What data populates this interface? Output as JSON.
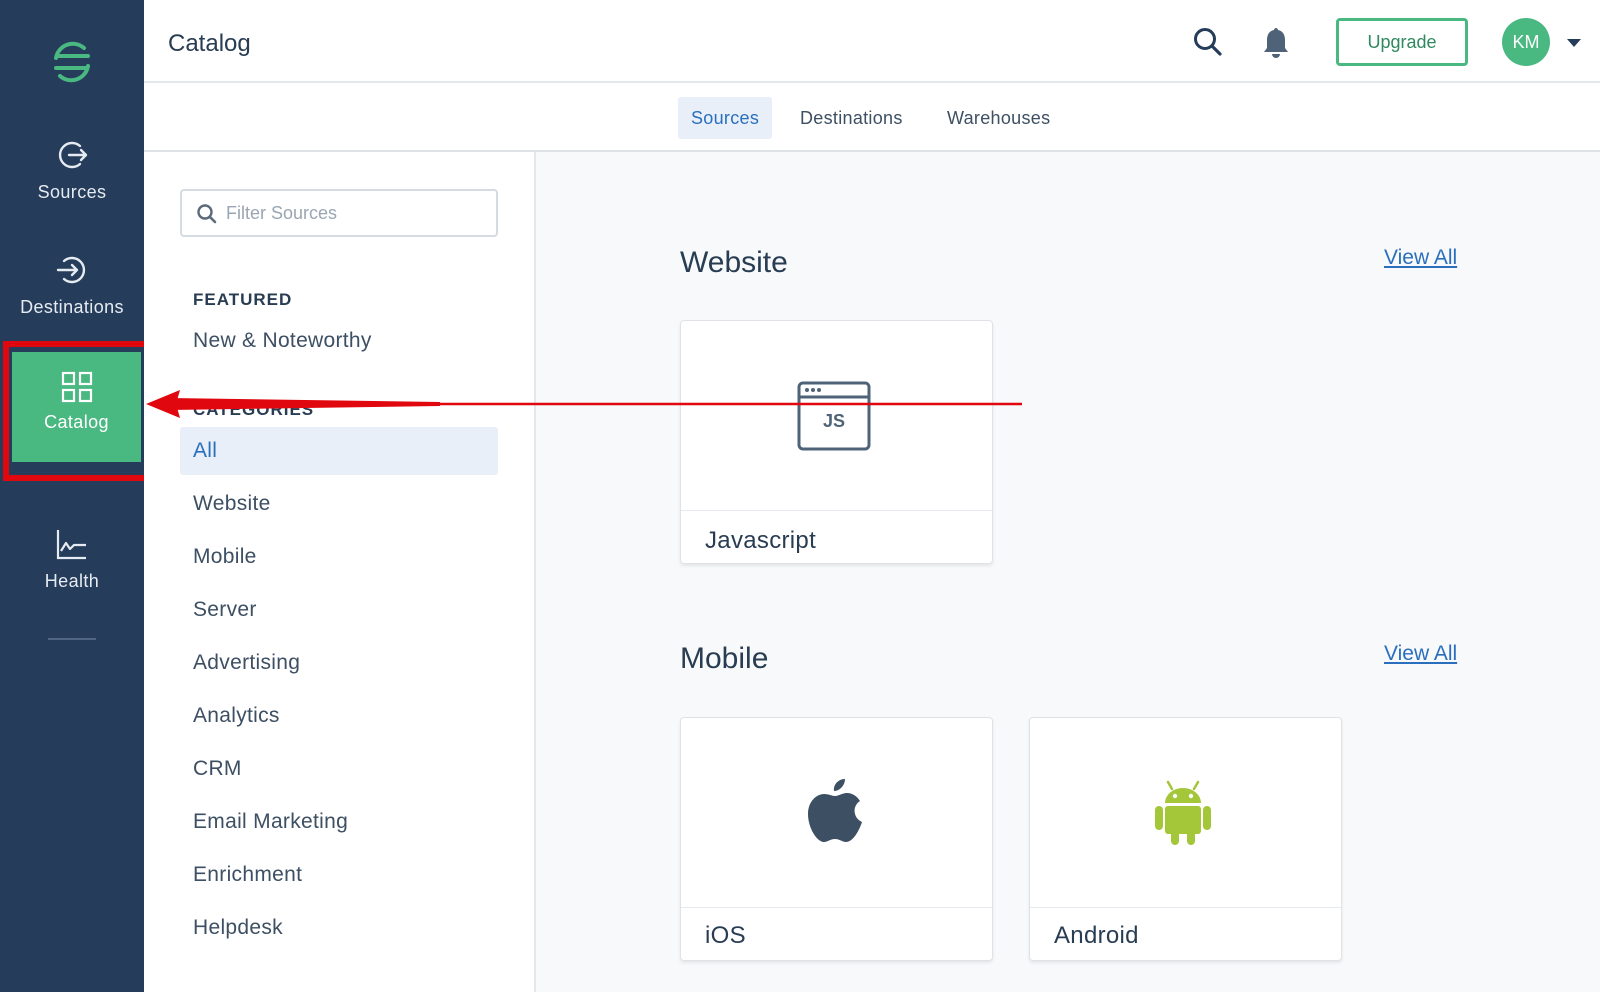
{
  "nav": {
    "items": [
      {
        "label": "Sources",
        "icon": "sources-icon"
      },
      {
        "label": "Destinations",
        "icon": "destinations-icon"
      },
      {
        "label": "Catalog",
        "icon": "catalog-grid-icon",
        "active": true
      },
      {
        "label": "Health",
        "icon": "health-chart-icon"
      }
    ],
    "active_color": "#49b881",
    "background": "#253d5b"
  },
  "header": {
    "title": "Catalog",
    "upgrade_label": "Upgrade",
    "avatar_initials": "KM"
  },
  "tabs": [
    {
      "label": "Sources",
      "active": true
    },
    {
      "label": "Destinations"
    },
    {
      "label": "Warehouses"
    }
  ],
  "sidebar": {
    "filter_placeholder": "Filter Sources",
    "featured_heading": "FEATURED",
    "featured_items": [
      "New & Noteworthy"
    ],
    "categories_heading": "CATEGORIES",
    "categories": [
      "All",
      "Website",
      "Mobile",
      "Server",
      "Advertising",
      "Analytics",
      "CRM",
      "Email Marketing",
      "Enrichment",
      "Helpdesk"
    ],
    "active_category": "All"
  },
  "sections": [
    {
      "title": "Website",
      "view_all": "View All",
      "cards": [
        {
          "label": "Javascript",
          "icon": "javascript-icon",
          "icon_text": "JS"
        }
      ]
    },
    {
      "title": "Mobile",
      "view_all": "View All",
      "cards": [
        {
          "label": "iOS",
          "icon": "apple-icon"
        },
        {
          "label": "Android",
          "icon": "android-icon"
        }
      ]
    }
  ],
  "annotation": {
    "color": "#e0070f",
    "target": "Catalog"
  }
}
